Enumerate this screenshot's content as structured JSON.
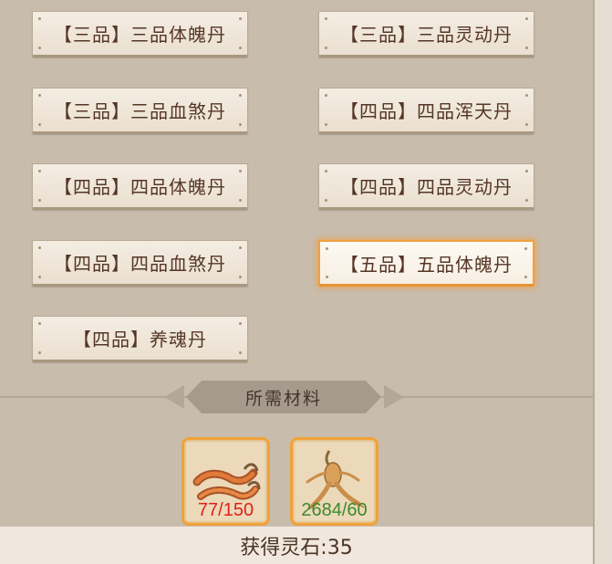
{
  "recipes": [
    {
      "label": "【三品】三品体魄丹",
      "selected": false
    },
    {
      "label": "【三品】三品灵动丹",
      "selected": false
    },
    {
      "label": "【三品】三品血煞丹",
      "selected": false
    },
    {
      "label": "【四品】四品浑天丹",
      "selected": false
    },
    {
      "label": "【四品】四品体魄丹",
      "selected": false
    },
    {
      "label": "【四品】四品灵动丹",
      "selected": false
    },
    {
      "label": "【四品】四品血煞丹",
      "selected": false
    },
    {
      "label": "【五品】五品体魄丹",
      "selected": true
    },
    {
      "label": "【四品】养魂丹",
      "selected": false
    }
  ],
  "materials_title": "所需材料",
  "materials": [
    {
      "icon": "cordyceps-icon",
      "count": "77/150",
      "status": "insufficient",
      "color": "#e0211b"
    },
    {
      "icon": "ginseng-icon",
      "count": "2684/60",
      "status": "sufficient",
      "color": "#3a8a2c"
    }
  ],
  "reward_text": "获得灵石:35",
  "colors": {
    "selected_border": "#f0a040",
    "button_text": "#553626",
    "background": "#c8bcad"
  }
}
